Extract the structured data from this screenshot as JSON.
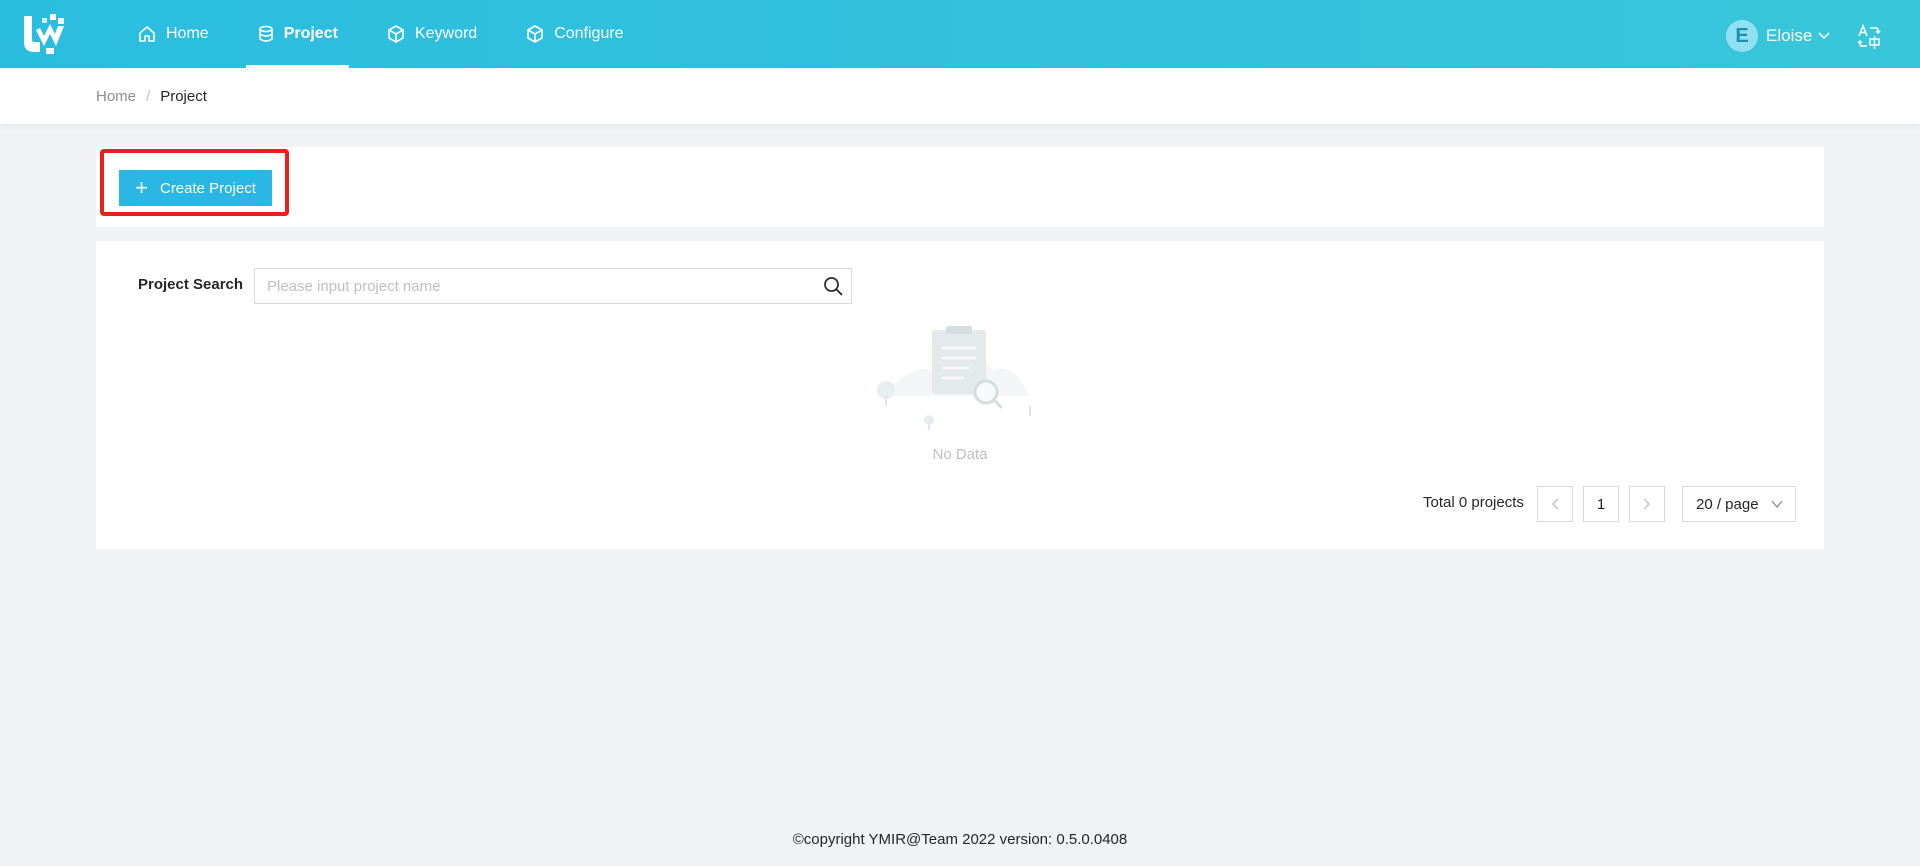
{
  "header": {
    "nav": [
      {
        "label": "Home",
        "icon": "home-icon",
        "active": false
      },
      {
        "label": "Project",
        "icon": "database-icon",
        "active": true
      },
      {
        "label": "Keyword",
        "icon": "cube-icon",
        "active": false
      },
      {
        "label": "Configure",
        "icon": "cube-icon",
        "active": false
      }
    ],
    "user": {
      "initial": "E",
      "name": "Eloise"
    },
    "accent_color": "#2bbde0"
  },
  "breadcrumb": {
    "home": "Home",
    "separator": "/",
    "current": "Project"
  },
  "actions": {
    "create_label": "Create Project",
    "create_color": "#2bb7e4",
    "highlight_color": "#e8211d"
  },
  "search": {
    "label": "Project Search",
    "placeholder": "Please input project name",
    "value": ""
  },
  "empty": {
    "text": "No Data"
  },
  "pagination": {
    "total_text": "Total 0 projects",
    "current_page": "1",
    "page_size": "20 / page"
  },
  "footer": {
    "text": "©copyright YMIR@Team 2022 version: 0.5.0.0408"
  }
}
